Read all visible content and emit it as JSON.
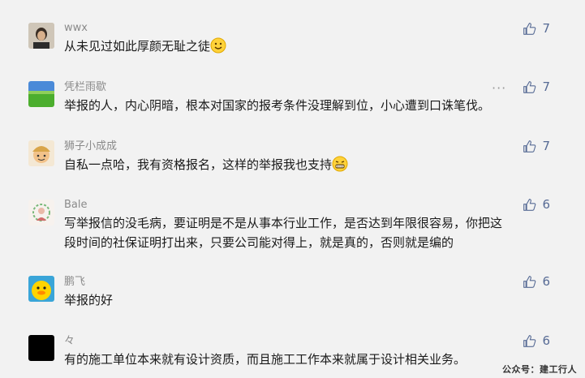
{
  "comments": [
    {
      "name": "wwx",
      "text": "从未见过如此厚颜无耻之徒",
      "emoji": "smile",
      "likes": "7"
    },
    {
      "name": "凭栏雨歇",
      "text": "举报的人，内心阴暗，根本对国家的报考条件没理解到位，小心遭到口诛笔伐。",
      "likes": "7"
    },
    {
      "name": "狮子小成成",
      "text": "自私一点哈，我有资格报名，这样的举报我也支持",
      "emoji": "grin",
      "likes": "7"
    },
    {
      "name": "Bale",
      "text_line1": "写举报信的没毛病，要证明是不是从事本行业工作，是否达到年限很容易，你把这",
      "text_line2": "段时间的社保证明打出来，只要公司能对得上，就是真的，否则就是编的",
      "likes": "6"
    },
    {
      "name": "鹏飞",
      "text": "举报的好",
      "likes": "6"
    },
    {
      "name": "々",
      "text": "有的施工单位本来就有设计资质，而且施工工作本来就属于设计相关业务。",
      "likes": "6"
    }
  ],
  "more_menu": "···",
  "watermark": "公众号：建工行人",
  "colors": {
    "like": "#576b95",
    "name": "#8a8a8a",
    "background": "#f2f2f2"
  },
  "icons": {
    "like": "thumbs-up-icon",
    "more": "more-dots-icon"
  }
}
